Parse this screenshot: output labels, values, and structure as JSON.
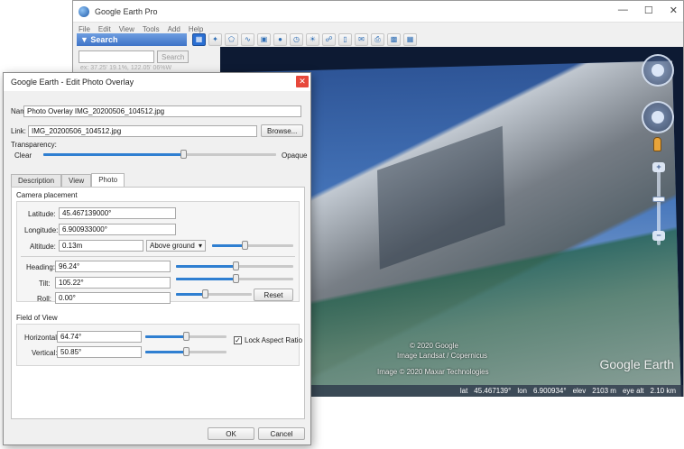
{
  "main_window": {
    "title": "Google Earth Pro",
    "menu": [
      "File",
      "Edit",
      "View",
      "Tools",
      "Add",
      "Help"
    ],
    "toolbar_icons": [
      "sidebar-toggle-icon",
      "add-placemark-icon",
      "add-polygon-icon",
      "add-path-icon",
      "add-image-overlay-icon",
      "record-tour-icon",
      "historical-imagery-icon",
      "sun-icon",
      "switch-planet-icon",
      "ruler-icon",
      "email-icon",
      "print-icon",
      "save-image-icon",
      "view-in-maps-icon"
    ],
    "sidebar": {
      "search_header": "Search",
      "search_button": "Search",
      "coord_hint": "ex: 37.25' 19.1%, 122.05' 06%W"
    },
    "map": {
      "attribution": [
        "© 2020 Google",
        "Image Landsat / Copernicus",
        "Image © 2020 Maxar Technologies"
      ],
      "brand": "Google Earth",
      "status": {
        "lat_label": "lat",
        "lat": "45.467139°",
        "lon_label": "lon",
        "lon": "6.900934°",
        "elev_label": "elev",
        "elev": "2103 m",
        "eye_label": "eye alt",
        "eye_alt": "2.10 km"
      }
    }
  },
  "dialog": {
    "title": "Google Earth - Edit Photo Overlay",
    "name_label": "Name:",
    "name_value": "Photo Overlay IMG_20200506_104512.jpg",
    "link_label": "Link:",
    "link_value": "IMG_20200506_104512.jpg",
    "browse_button": "Browse...",
    "transparency_label": "Transparency:",
    "transparency_clear": "Clear",
    "transparency_opaque": "Opaque",
    "transparency_level": 0.6,
    "tabs": [
      "Description",
      "View",
      "Photo"
    ],
    "active_tab": "Photo",
    "camera": {
      "section_title": "Camera placement",
      "latitude_label": "Latitude:",
      "latitude": "45.467139000°",
      "longitude_label": "Longitude:",
      "longitude": "6.900933000°",
      "altitude_label": "Altitude:",
      "altitude": "0.13m",
      "altitude_mode": "Above ground",
      "altitude_level": 0.4,
      "heading_label": "Heading:",
      "heading": "96.24°",
      "heading_level": 0.51,
      "tilt_label": "Tilt:",
      "tilt": "105.22°",
      "tilt_level": 0.51,
      "roll_label": "Roll:",
      "roll": "0.00°",
      "roll_level": 0.38,
      "reset_button": "Reset"
    },
    "fov": {
      "section_title": "Field of View",
      "horizontal_label": "Horizontal:",
      "horizontal": "64.74°",
      "horizontal_level": 0.5,
      "vertical_label": "Vertical:",
      "vertical": "50.85°",
      "vertical_level": 0.5,
      "lock_label": "Lock Aspect Ratio",
      "lock_checked": true
    },
    "ok_button": "OK",
    "cancel_button": "Cancel"
  }
}
